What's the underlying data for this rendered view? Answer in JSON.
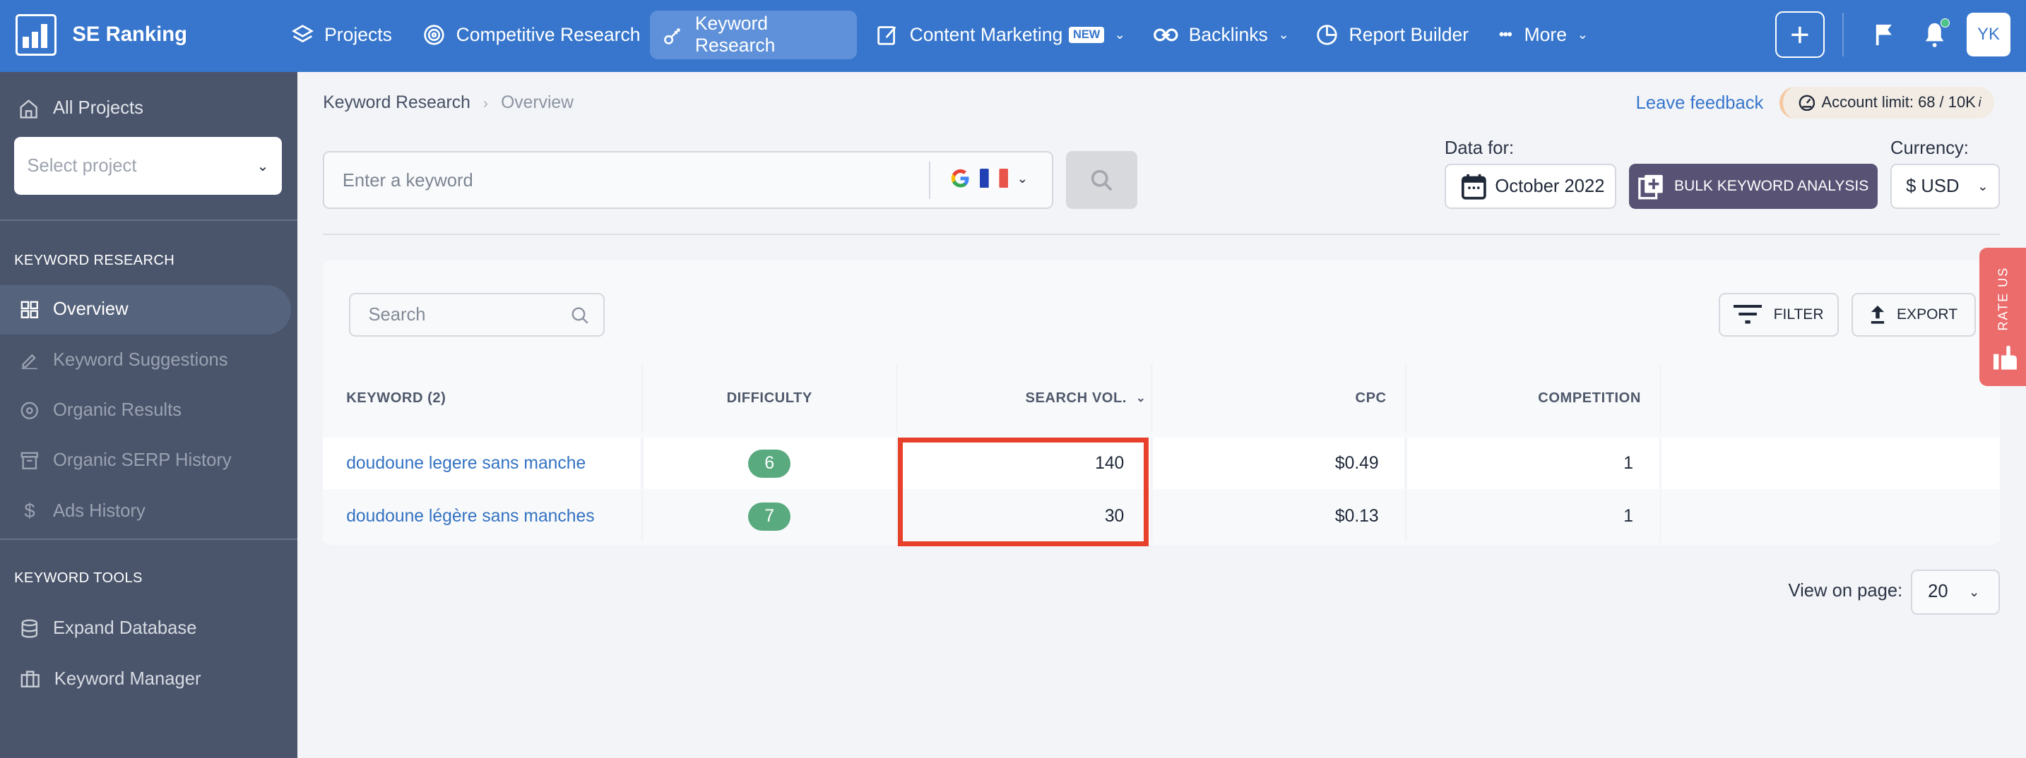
{
  "app": {
    "brand": "SE Ranking",
    "nav": [
      {
        "label": "Projects",
        "icon": "layers-icon"
      },
      {
        "label": "Competitive Research",
        "icon": "target-icon"
      },
      {
        "label": "Keyword Research",
        "icon": "key-icon",
        "active": true
      },
      {
        "label": "Content Marketing",
        "icon": "edit-icon",
        "badge": "NEW",
        "dropdown": true
      },
      {
        "label": "Backlinks",
        "icon": "link-icon",
        "dropdown": true
      },
      {
        "label": "Report Builder",
        "icon": "pie-chart-icon"
      },
      {
        "label": "More",
        "icon": "ellipsis-icon",
        "dropdown": true
      }
    ],
    "avatar_initials": "YK",
    "colors": {
      "brand": "#3776cc",
      "sidebar": "#4a556c",
      "bulk_button": "#585275",
      "difficulty_badge": "#5aaa7f",
      "highlight": "#e8412b",
      "rate_us": "#ec6b6b"
    }
  },
  "sidebar": {
    "all_projects": "All Projects",
    "select_project_placeholder": "Select project",
    "section1_title": "KEYWORD RESEARCH",
    "section1_items": [
      {
        "label": "Overview",
        "icon": "grid-icon",
        "active": true
      },
      {
        "label": "Keyword Suggestions",
        "icon": "pencil-icon"
      },
      {
        "label": "Organic Results",
        "icon": "target-icon"
      },
      {
        "label": "Organic SERP History",
        "icon": "archive-icon"
      },
      {
        "label": "Ads History",
        "icon": "dollar-icon"
      }
    ],
    "section2_title": "KEYWORD TOOLS",
    "section2_items": [
      {
        "label": "Expand Database",
        "icon": "database-icon"
      },
      {
        "label": "Keyword Manager",
        "icon": "briefcase-icon"
      }
    ]
  },
  "main": {
    "breadcrumb": {
      "parent": "Keyword Research",
      "separator": "›",
      "current": "Overview"
    },
    "leave_feedback": "Leave feedback",
    "account_limit": {
      "label": "Account limit:",
      "value": "68 / 10K",
      "info": "i"
    },
    "keyword_placeholder": "Enter a keyword",
    "search_engine": "Google",
    "country": "France",
    "data_for_label": "Data for:",
    "date": "October 2022",
    "bulk_button": "BULK KEYWORD ANALYSIS",
    "currency_label": "Currency:",
    "currency": "$ USD",
    "table_search_placeholder": "Search",
    "filter_button": "FILTER",
    "export_button": "EXPORT",
    "rate_us": "RATE US",
    "table": {
      "columns": [
        "KEYWORD  (2)",
        "DIFFICULTY",
        "SEARCH VOL.",
        "CPC",
        "COMPETITION"
      ],
      "rows": [
        {
          "keyword": "doudoune legere sans manche",
          "difficulty": "6",
          "search_vol": "140",
          "cpc": "$0.49",
          "competition": "1"
        },
        {
          "keyword": "doudoune légère sans manches",
          "difficulty": "7",
          "search_vol": "30",
          "cpc": "$0.13",
          "competition": "1"
        }
      ]
    },
    "view_on_page_label": "View on page:",
    "view_on_page_value": "20"
  }
}
